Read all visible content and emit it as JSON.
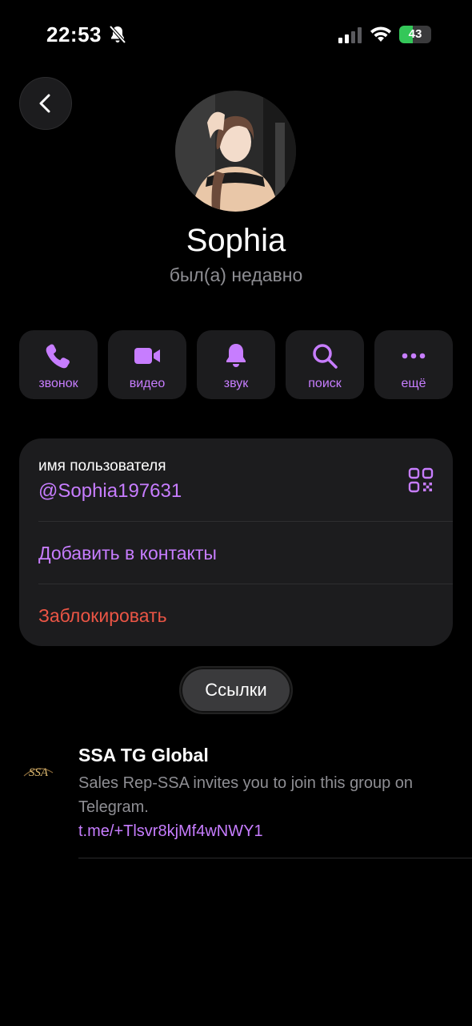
{
  "status_bar": {
    "time": "22:53",
    "battery_percent": 43,
    "battery_label": "43"
  },
  "profile": {
    "name": "Sophia",
    "status": "был(а) недавно"
  },
  "actions": [
    {
      "label": "звонок",
      "icon": "phone-icon"
    },
    {
      "label": "видео",
      "icon": "video-camera-icon"
    },
    {
      "label": "звук",
      "icon": "bell-icon"
    },
    {
      "label": "поиск",
      "icon": "search-icon"
    },
    {
      "label": "ещё",
      "icon": "more-dots-icon"
    }
  ],
  "info": {
    "username_caption": "имя пользователя",
    "username": "@Sophia197631",
    "add_contact": "Добавить в контакты",
    "block": "Заблокировать"
  },
  "links_tab": {
    "label": "Ссылки"
  },
  "links": [
    {
      "logo_text": "SSA",
      "title": "SSA TG Global",
      "description": "Sales Rep-SSA invites you to join this group on Telegram.",
      "url": "t.me/+Tlsvr8kjMf4wNWY1"
    }
  ],
  "colors": {
    "accent": "#c77dff",
    "danger": "#eb5545",
    "card": "#1c1c1e",
    "background": "#000000",
    "secondary_text": "#8e8e93",
    "battery": "#34c759"
  }
}
